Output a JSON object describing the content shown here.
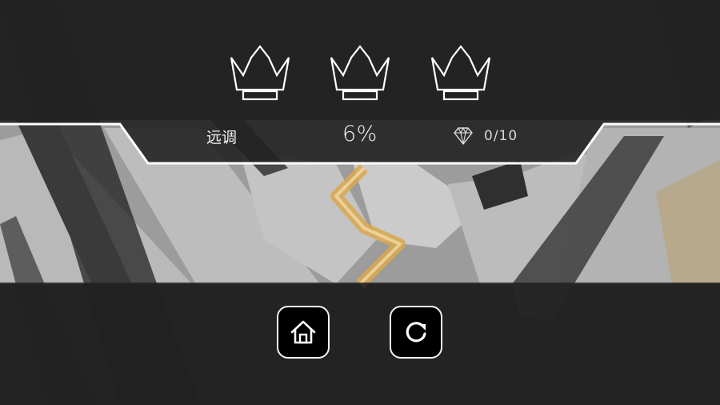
{
  "level": {
    "name": "远调",
    "progress": "6%",
    "gems": "0/10"
  },
  "crowns": [
    {
      "icon": "crown-icon",
      "earned": false
    },
    {
      "icon": "crown-icon",
      "earned": false
    },
    {
      "icon": "crown-icon",
      "earned": false
    }
  ],
  "buttons": {
    "home_icon": "home-icon",
    "restart_icon": "restart-icon"
  },
  "colors": {
    "overlay_dark": "#222222",
    "outline": "#ffffff",
    "track_gold": "#d9a850"
  }
}
